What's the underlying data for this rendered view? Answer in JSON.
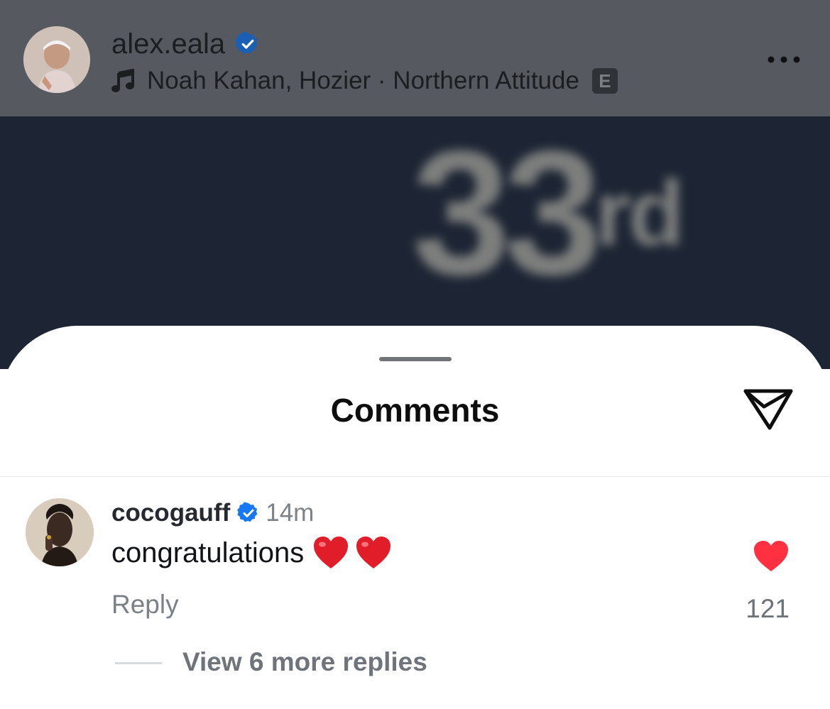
{
  "post_header": {
    "username": "alex.eala",
    "verified_icon": "verified-badge-icon",
    "music_icon": "music-note-icon",
    "music": "Noah Kahan, Hozier · Northern Attitude",
    "explicit_badge": "E",
    "more_icon": "more-options-icon"
  },
  "background_image": {
    "text": "33",
    "superscript": "rd"
  },
  "comments_sheet": {
    "title": "Comments",
    "share_icon": "send-icon",
    "comment": {
      "username": "cocogauff",
      "verified_icon": "verified-badge-icon",
      "timestamp": "14m",
      "text": "congratulations",
      "emojis": [
        "❤️",
        "❤️"
      ],
      "reply_label": "Reply",
      "like_icon": "heart-filled-icon",
      "like_count": "121",
      "view_replies_label": "View 6 more replies"
    }
  },
  "colors": {
    "verified": "#1877f2",
    "heart": "#ff3040",
    "header_overlay": "#565a60",
    "backdrop": "#1d2534"
  }
}
